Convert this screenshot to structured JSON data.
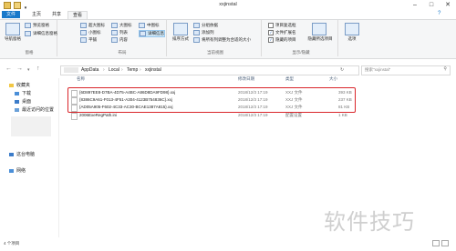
{
  "window": {
    "title": "xxjinstal",
    "qa_icons": [
      "save-icon",
      "folder-icon",
      "dropdown-icon"
    ]
  },
  "tabs": {
    "file": "文件",
    "home": "主页",
    "share": "共享",
    "view": "查看"
  },
  "ribbon": {
    "pane": {
      "nav_pane": "导航窗格",
      "preview_pane": "预览窗格",
      "details_pane": "详细信息窗格",
      "label": "窗格"
    },
    "layout": {
      "items": [
        "超大图标",
        "大图标",
        "中图标",
        "小图标",
        "列表",
        "详细信息",
        "平铺",
        "内容"
      ],
      "label": "布局"
    },
    "current_view": {
      "sort_by": "排序方式",
      "group_by": "分组依据",
      "add_columns": "添加列",
      "fit_columns": "将所有列调整为合适的大小",
      "label": "当前视图"
    },
    "show_hide": {
      "item_checkboxes": "项目复选框",
      "file_extensions": "文件扩展名",
      "hidden_items": "隐藏的项目",
      "hide_selected": "隐藏所选项目",
      "label": "显示/隐藏"
    },
    "options": "选项"
  },
  "address": {
    "crumbs": [
      "AppData",
      "Local",
      "Temp",
      "xxjinstal"
    ],
    "search_placeholder": "搜索\"xxjinstal\""
  },
  "sidebar": {
    "items": [
      {
        "label": "收藏夹",
        "icon": "star-icon"
      },
      {
        "label": "下载",
        "icon": "download-icon"
      },
      {
        "label": "桌面",
        "icon": "desktop-icon"
      },
      {
        "label": "最近访问的位置",
        "icon": "recent-icon"
      },
      {
        "label": "这台电脑",
        "icon": "computer-icon"
      },
      {
        "label": "网络",
        "icon": "network-icon"
      }
    ]
  },
  "columns": {
    "name": "名称",
    "date": "修改日期",
    "type": "类型",
    "size": "大小"
  },
  "files": [
    {
      "name": "{6D897EE8-D7BA-4D75-A4BC-A86D8DA9FD98}.xxj",
      "date": "2018/12/3 17:19",
      "type": "XXJ 文件",
      "size": "393 KB"
    },
    {
      "name": "{8386C9A61-F013-4F51-A304-4123B754836C}.xxj",
      "date": "2018/12/3 17:19",
      "type": "XXJ 文件",
      "size": "237 KB"
    },
    {
      "name": "{AD05A905-F602-4C33-AC30-BCAE1387A815}.xxj",
      "date": "2018/12/3 17:19",
      "type": "XXJ 文件",
      "size": "81 KB"
    },
    {
      "name": "2006ExeRegPath.ini",
      "date": "2018/12/3 17:19",
      "type": "配置设置",
      "size": "1 KB"
    }
  ],
  "status": {
    "count": "4 个项目"
  },
  "watermark": "软件技巧"
}
